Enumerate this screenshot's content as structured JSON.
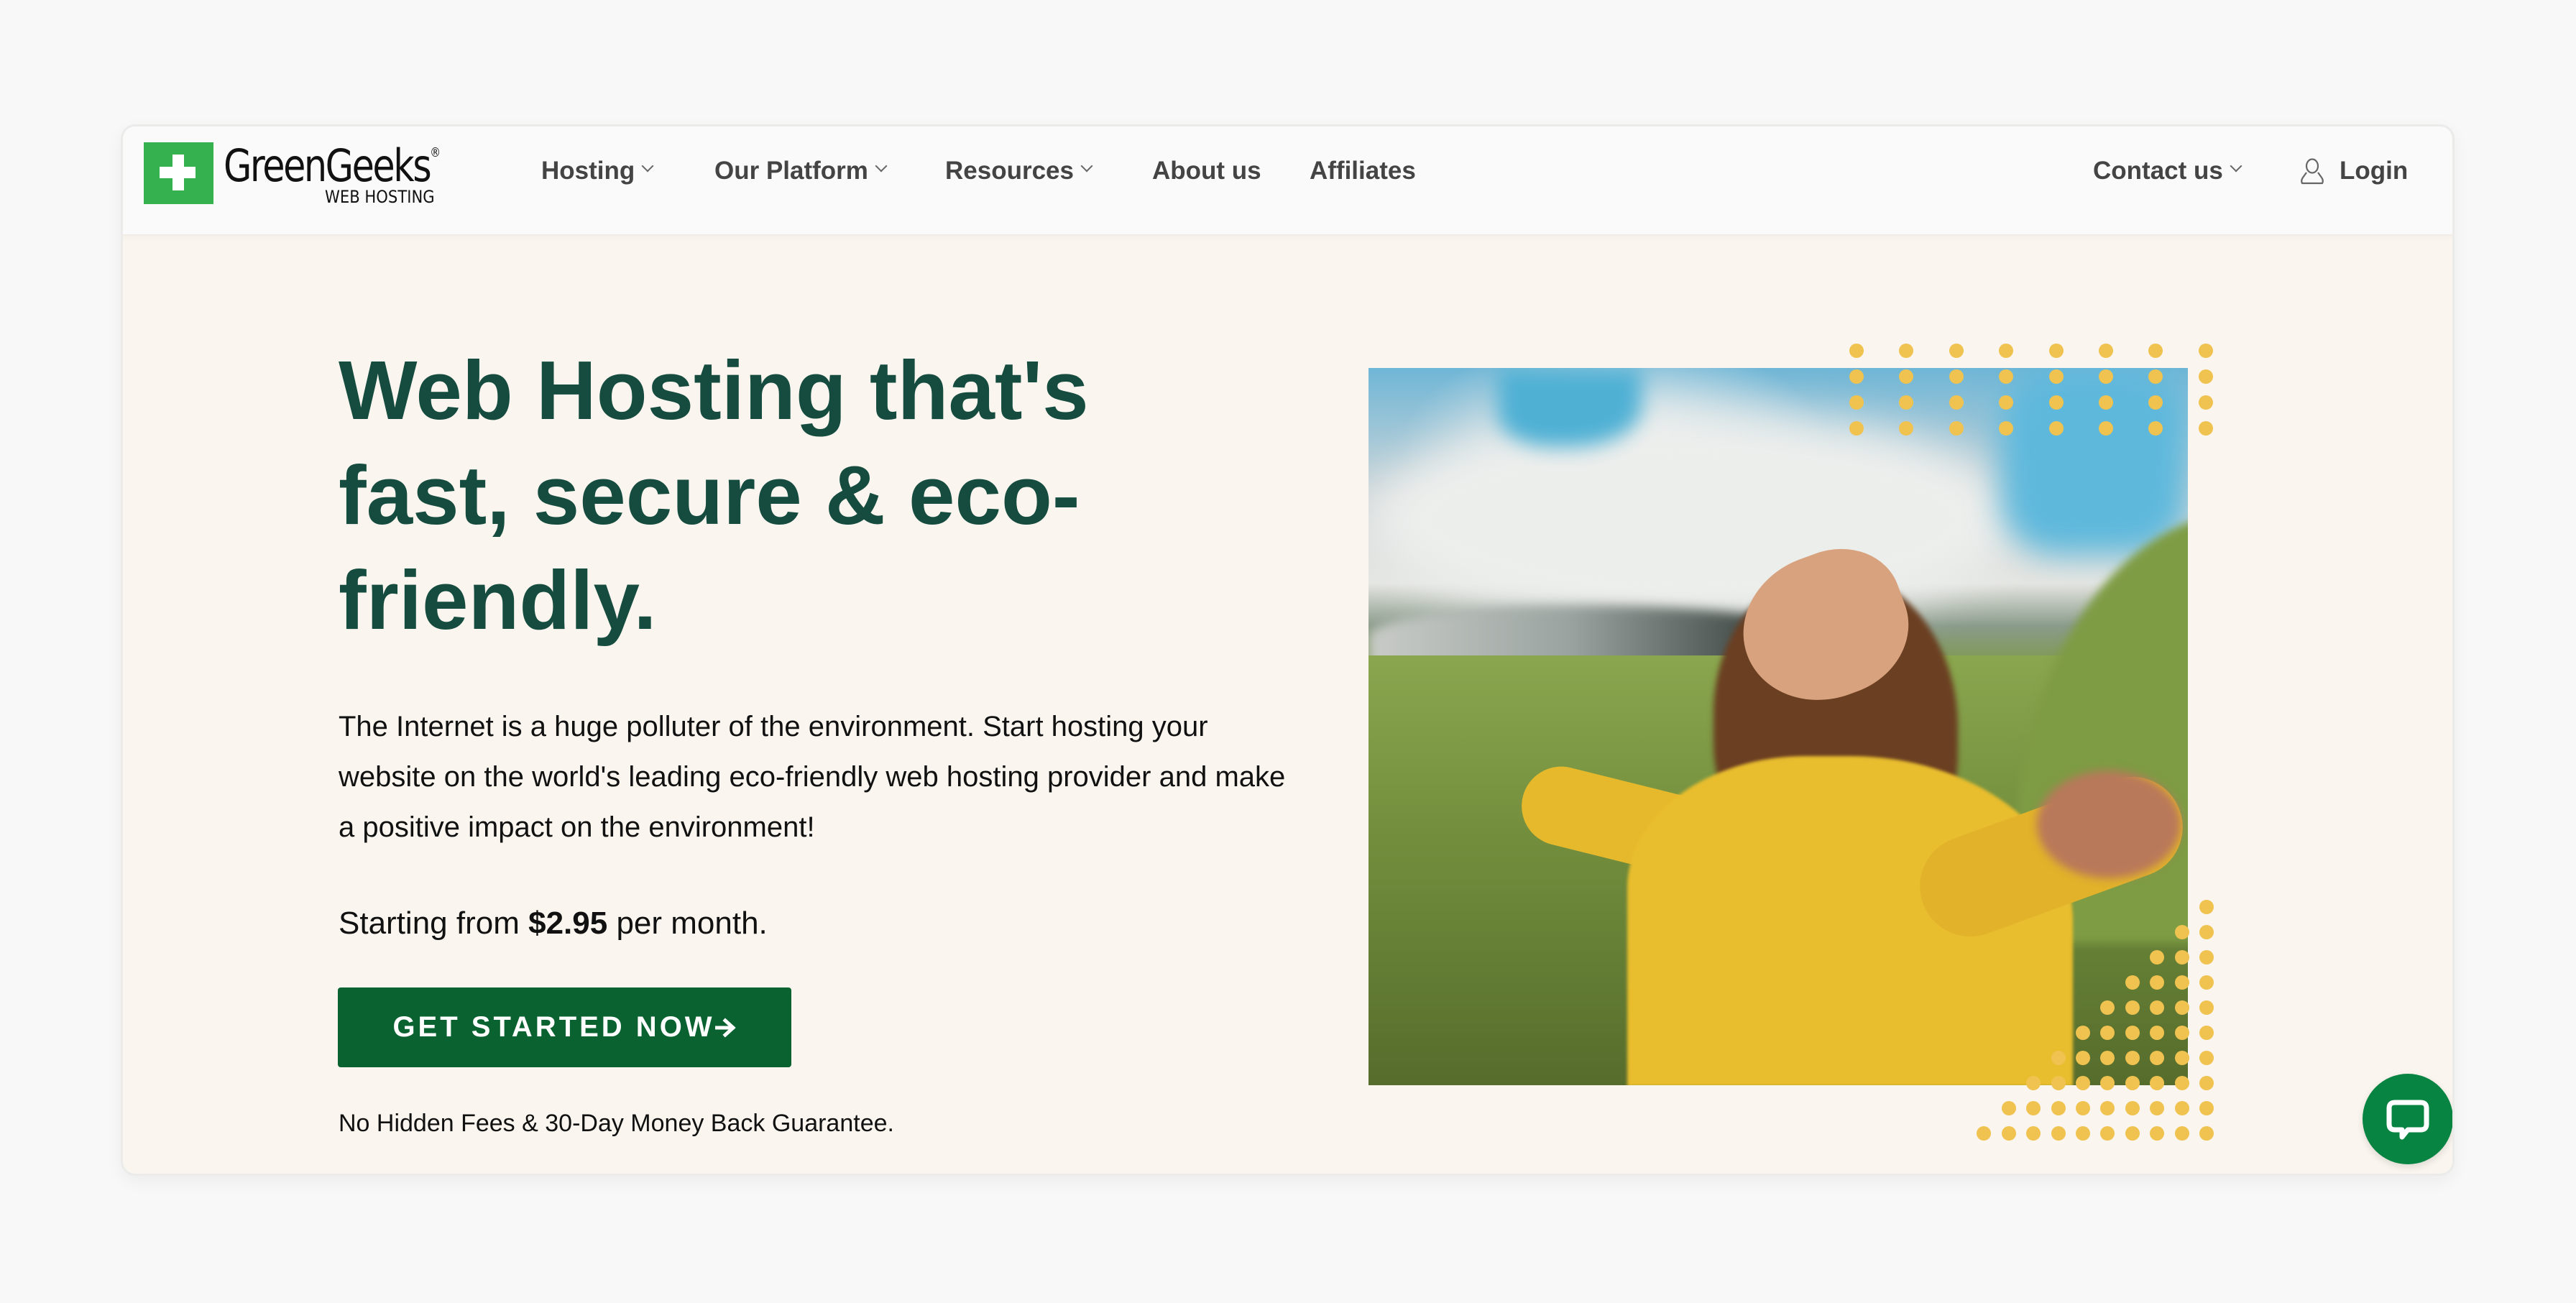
{
  "brand": {
    "name": "GreenGeeks",
    "registered": "®",
    "tagline": "WEB HOSTING",
    "logo_icon": "plus-icon",
    "logo_color": "#35b24f"
  },
  "nav": {
    "items": [
      {
        "label": "Hosting",
        "dropdown": true
      },
      {
        "label": "Our Platform",
        "dropdown": true
      },
      {
        "label": "Resources",
        "dropdown": true
      },
      {
        "label": "About us",
        "dropdown": false
      },
      {
        "label": "Affiliates",
        "dropdown": false
      }
    ],
    "contact": {
      "label": "Contact us",
      "dropdown": true
    },
    "login": {
      "label": "Login",
      "icon": "user-icon"
    }
  },
  "hero": {
    "title": "Web Hosting that's fast, secure & eco-friendly.",
    "description": "The Internet is a huge polluter of the environment. Start hosting your website on the world's leading eco-friendly web hosting provider and make a positive impact on the environment!",
    "price_prefix": "Starting from",
    "price": "$2.95",
    "price_suffix": "per month.",
    "cta_label": "GET STARTED NOW",
    "cta_icon": "arrow-right-icon",
    "footnote": "No Hidden Fees & 30-Day Money Back Guarantee.",
    "image_alt": "Woman in yellow jacket with arms outstretched in green mountain landscape"
  },
  "chat": {
    "icon": "chat-bubble-icon"
  },
  "colors": {
    "heading": "#154c3f",
    "cta": "#0a6230",
    "chat": "#088442",
    "accent_dots": "#f0c350",
    "hero_bg": "#faf6ef"
  }
}
